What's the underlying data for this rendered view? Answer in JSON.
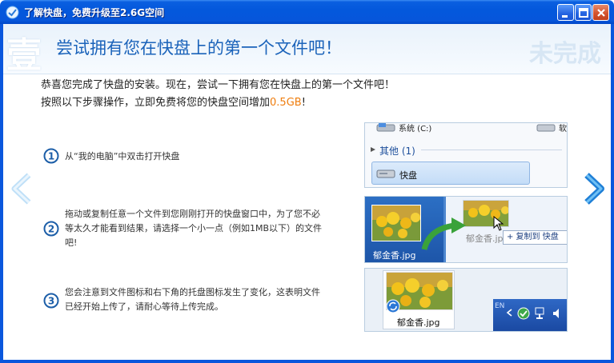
{
  "window": {
    "title": "了解快盘，免费升级至2.6G空间"
  },
  "header": {
    "step_mark": "壹",
    "title": "尝试拥有您在快盘上的第一个文件吧！",
    "status": "未完成"
  },
  "intro": {
    "line1": "恭喜您完成了快盘的安装。现在，尝试一下拥有您在快盘上的第一个文件吧！",
    "line2_prefix": "按照以下步骤操作，立即免费将您的快盘空间增加",
    "line2_amount": "0.5GB",
    "line2_suffix": "!"
  },
  "steps": [
    {
      "number": "1",
      "text": "从“我的电脑”中双击打开快盘"
    },
    {
      "number": "2",
      "text_line1": "拖动或复制任意一个文件到您刚刚打开的快盘窗口中，为了您不必",
      "text_line2": "等太久才能看到结果，请选择一个小一点（例如1MB以下）的文件",
      "text_line3": "吧!"
    },
    {
      "number": "3",
      "text_line1": "您会注意到文件图标和右下角的托盘图标发生了变化，这表明文件",
      "text_line2": "已经开始上传了，请耐心等待上传完成。"
    }
  ],
  "illustrations": {
    "panel1": {
      "drive_c": "系统 (C:)",
      "drive_right": "软",
      "group": "其他 (1)",
      "kuaipan": "快盘"
    },
    "panel2": {
      "file_name": "郁金香.jpg",
      "file_name_target": "郁金香.jp",
      "copy_tip": "+ 复制到 快盘"
    },
    "panel3": {
      "file_name": "郁金香.jpg",
      "taskbar_text": "EN"
    }
  },
  "colors": {
    "title_bar": "#0458dc",
    "header_title": "#1b63ba",
    "highlight": "#ef7d0e",
    "nav_arrow": "#2a8de0"
  }
}
